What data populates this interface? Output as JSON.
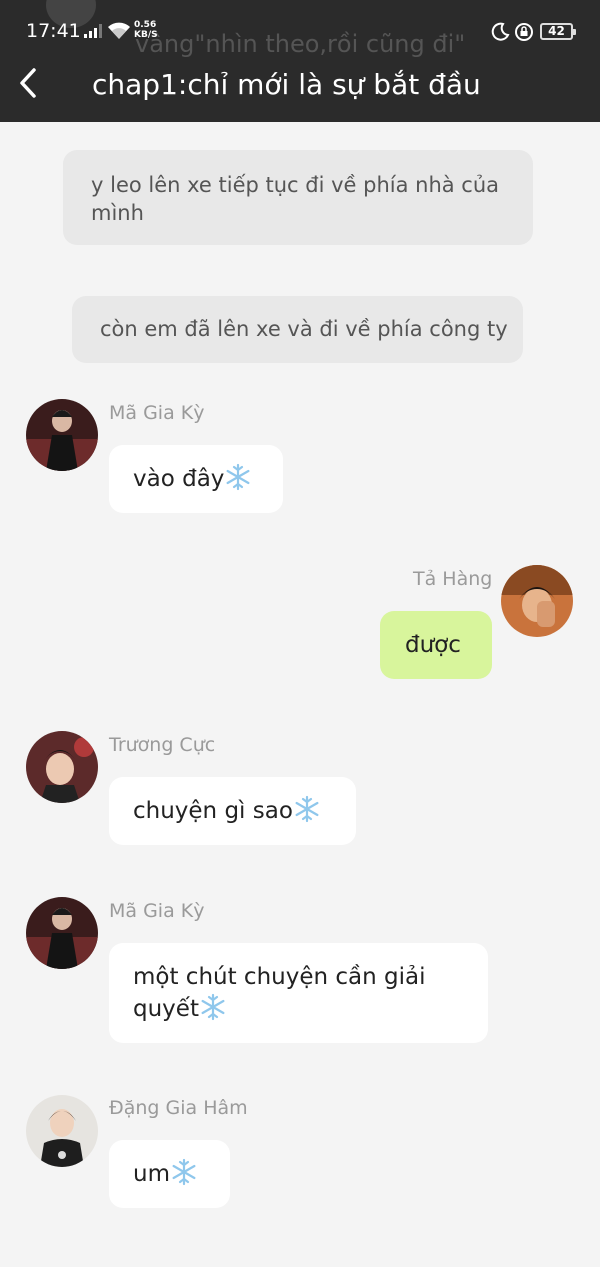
{
  "status_bar": {
    "time": "17:41",
    "net_speed_value": "0.56",
    "net_speed_unit": "KB/S",
    "battery": "42"
  },
  "header": {
    "title": "chap1:chỉ mới là sự bắt đầu",
    "ghost_text": "vâng\"nhìn theo,rồi cũng đi\""
  },
  "narrations": [
    {
      "text": "y leo lên xe tiếp tục đi về phía nhà của mình"
    },
    {
      "text": "còn em đã lên xe và đi về phía công ty"
    }
  ],
  "messages": [
    {
      "sender": "Mã Gia Kỳ",
      "text": "vào đây",
      "side": "left",
      "emoji": "snowflake-icon"
    },
    {
      "sender": "Tả Hàng",
      "text": "được",
      "side": "right"
    },
    {
      "sender": "Trương Cực",
      "text": "chuyện gì sao",
      "side": "left",
      "emoji": "snowflake-icon"
    },
    {
      "sender": "Mã Gia Kỳ",
      "text": "một chút chuyện cần giải quyết",
      "side": "left",
      "emoji": "snowflake-icon"
    },
    {
      "sender": "Đặng Gia Hâm",
      "text": "um",
      "side": "left",
      "emoji": "snowflake-icon"
    }
  ],
  "colors": {
    "header_bg": "#2b2b2b",
    "page_bg": "#f4f4f4",
    "narration_bg": "#e8e8e8",
    "bubble_left": "#ffffff",
    "bubble_right": "#d8f59c",
    "sender_text": "#9a9a9a"
  }
}
